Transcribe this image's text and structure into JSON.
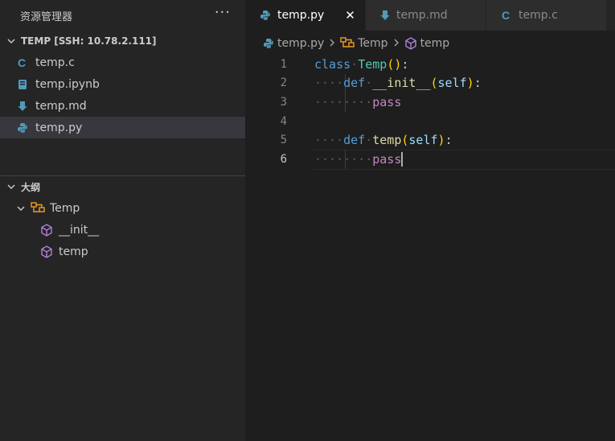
{
  "sidebar": {
    "title": "资源管理器",
    "more_label": "···",
    "workspace": "TEMP [SSH: 10.78.2.111]",
    "files": [
      {
        "name": "temp.c",
        "icon": "c-file-icon",
        "color": "#519aba"
      },
      {
        "name": "temp.ipynb",
        "icon": "notebook-file-icon",
        "color": "#519aba"
      },
      {
        "name": "temp.md",
        "icon": "markdown-file-icon",
        "color": "#519aba"
      },
      {
        "name": "temp.py",
        "icon": "python-file-icon",
        "color": "#519aba"
      }
    ],
    "selected_file": "temp.py",
    "outline": {
      "title": "大纲",
      "items": [
        {
          "name": "Temp",
          "icon": "class-icon",
          "color": "#ee9d28"
        },
        {
          "name": "__init__",
          "icon": "method-icon",
          "color": "#b180d7"
        },
        {
          "name": "temp",
          "icon": "method-icon",
          "color": "#b180d7"
        }
      ]
    }
  },
  "tabs": [
    {
      "label": "temp.py",
      "icon": "python-file-icon",
      "active": true,
      "close_label": "✕"
    },
    {
      "label": "temp.md",
      "icon": "markdown-file-icon",
      "active": false
    },
    {
      "label": "temp.c",
      "icon": "c-file-icon",
      "active": false
    }
  ],
  "breadcrumb": [
    "temp.py",
    "Temp",
    "temp"
  ],
  "editor": {
    "current_line": 6,
    "lines": [
      {
        "num": "1",
        "text": "class Temp():"
      },
      {
        "num": "2",
        "text": "    def __init__(self):"
      },
      {
        "num": "3",
        "text": "        pass"
      },
      {
        "num": "4",
        "text": ""
      },
      {
        "num": "5",
        "text": "    def temp(self):"
      },
      {
        "num": "6",
        "text": "        pass"
      }
    ],
    "tokens": {
      "class_kw": "class",
      "class_name": "Temp",
      "def_kw": "def",
      "init_name": "__init__",
      "temp_name": "temp",
      "self_kw": "self",
      "pass_kw": "pass",
      "open_paren": "(",
      "close_paren": ")",
      "colon": ":",
      "empty_parens": "()"
    }
  },
  "colors": {
    "accent_keyword": "#569cd6",
    "class_name": "#4ec9b0",
    "function_name": "#dcdcaa",
    "control_keyword": "#c586c0",
    "bracket": "#ffd700",
    "parameter": "#9cdcfe"
  }
}
